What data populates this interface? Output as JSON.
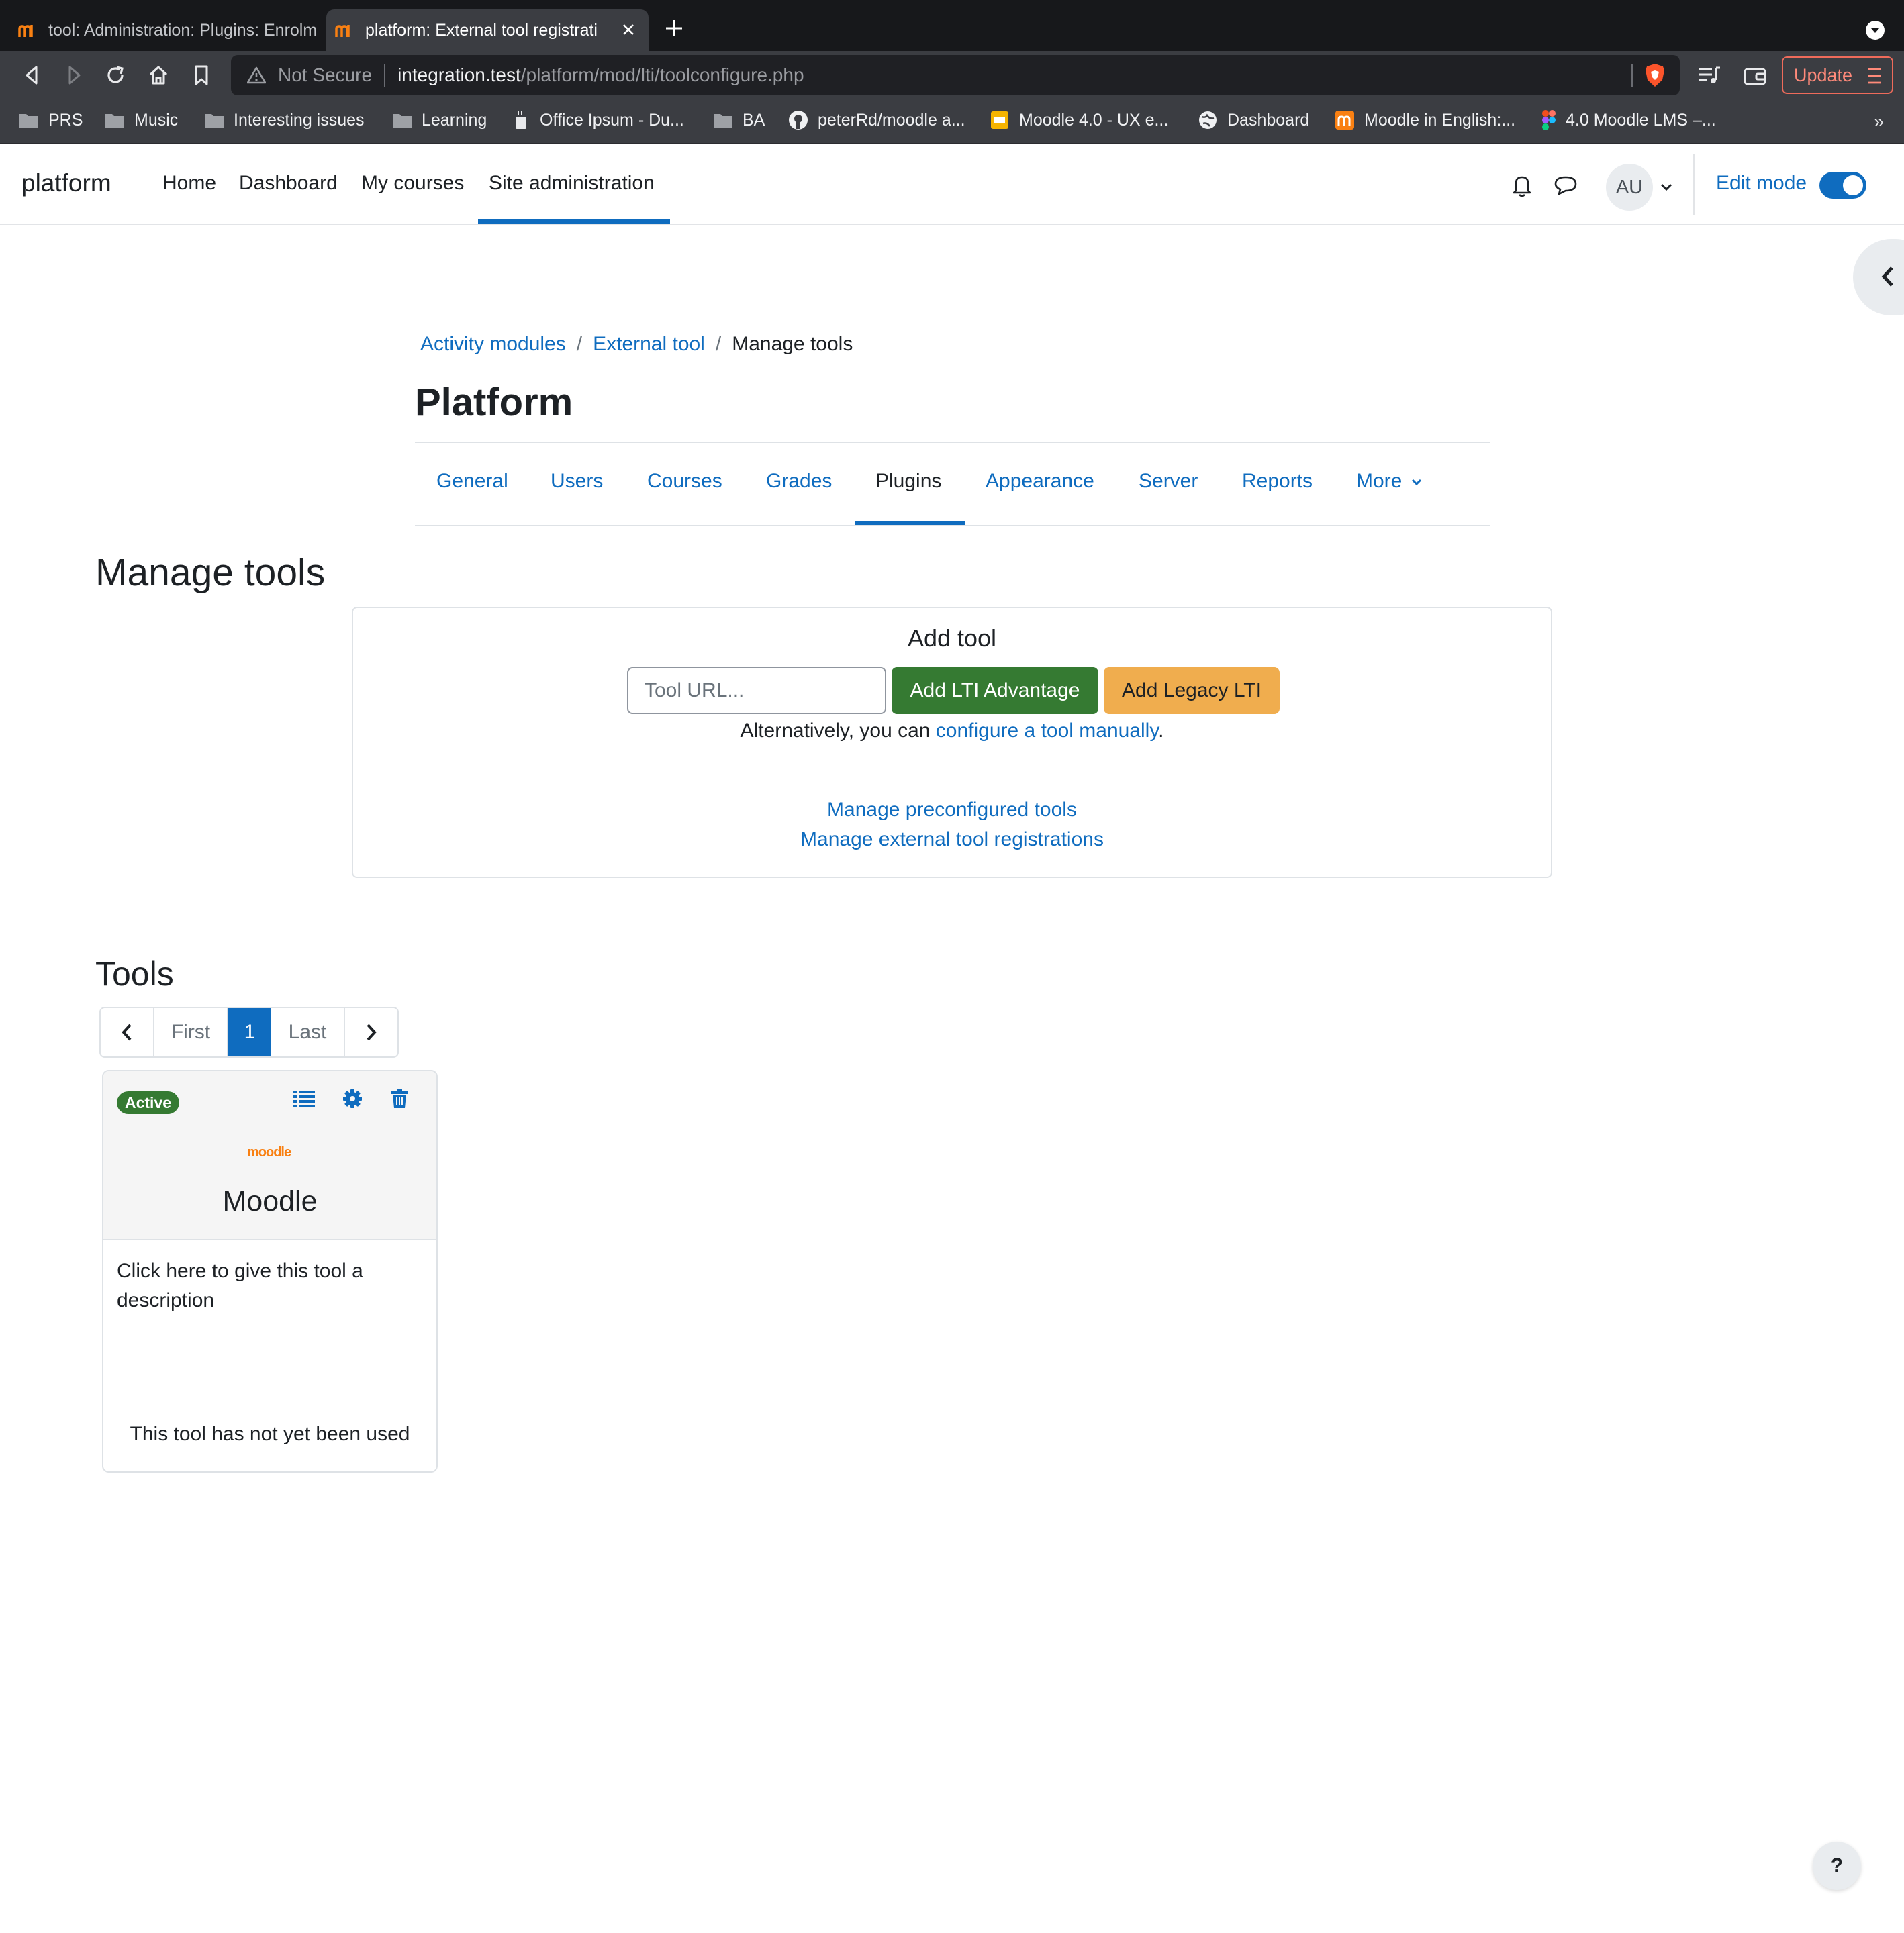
{
  "browser": {
    "tabs": [
      {
        "title": "tool: Administration: Plugins: Enrolm",
        "active": false
      },
      {
        "title": "platform: External tool registrati",
        "active": true
      }
    ],
    "address": {
      "security": "Not Secure",
      "host": "integration.test",
      "path": "/platform/mod/lti/toolconfigure.php"
    },
    "update_label": "Update",
    "bookmarks": [
      {
        "label": "PRS",
        "icon": "folder-icon"
      },
      {
        "label": "Music",
        "icon": "folder-icon"
      },
      {
        "label": "Interesting issues",
        "icon": "folder-icon"
      },
      {
        "label": "Learning",
        "icon": "folder-icon"
      },
      {
        "label": "Office Ipsum - Du...",
        "icon": "coffee-icon"
      },
      {
        "label": "BA",
        "icon": "folder-icon"
      },
      {
        "label": "peterRd/moodle a...",
        "icon": "github-icon"
      },
      {
        "label": "Moodle 4.0 - UX e...",
        "icon": "slides-icon"
      },
      {
        "label": "Dashboard",
        "icon": "globe-icon"
      },
      {
        "label": "Moodle in English:...",
        "icon": "moodle-icon"
      },
      {
        "label": "4.0 Moodle LMS –...",
        "icon": "figma-icon"
      }
    ],
    "bookmarks_more": "»"
  },
  "site": {
    "brand": "platform",
    "nav": [
      "Home",
      "Dashboard",
      "My courses",
      "Site administration"
    ],
    "active_nav": "Site administration",
    "avatar_initials": "AU",
    "edit_mode_label": "Edit mode",
    "edit_mode_on": true
  },
  "page": {
    "breadcrumb": [
      "Activity modules",
      "External tool",
      "Manage tools"
    ],
    "title": "Platform",
    "tabs": [
      "General",
      "Users",
      "Courses",
      "Grades",
      "Plugins",
      "Appearance",
      "Server",
      "Reports",
      "More"
    ],
    "active_tab": "Plugins"
  },
  "manage": {
    "heading": "Manage tools",
    "add_tool_title": "Add tool",
    "url_placeholder": "Tool URL...",
    "add_advantage_label": "Add LTI Advantage",
    "add_legacy_label": "Add Legacy LTI",
    "alt_prefix": "Alternatively, you can ",
    "alt_link": "configure a tool manually",
    "alt_suffix": ".",
    "links": [
      "Manage preconfigured tools",
      "Manage external tool registrations"
    ]
  },
  "tools": {
    "heading": "Tools",
    "pager": {
      "first": "First",
      "current": "1",
      "last": "Last"
    },
    "cards": [
      {
        "status": "Active",
        "logo_text": "moodle",
        "name": "Moodle",
        "description": "Click here to give this tool a description",
        "usage": "This tool has not yet been used"
      }
    ]
  },
  "help_label": "?",
  "colors": {
    "primary": "#0f6cbf",
    "success": "#357a32",
    "warning": "#f0ad4e",
    "moodle_orange": "#f98012"
  }
}
